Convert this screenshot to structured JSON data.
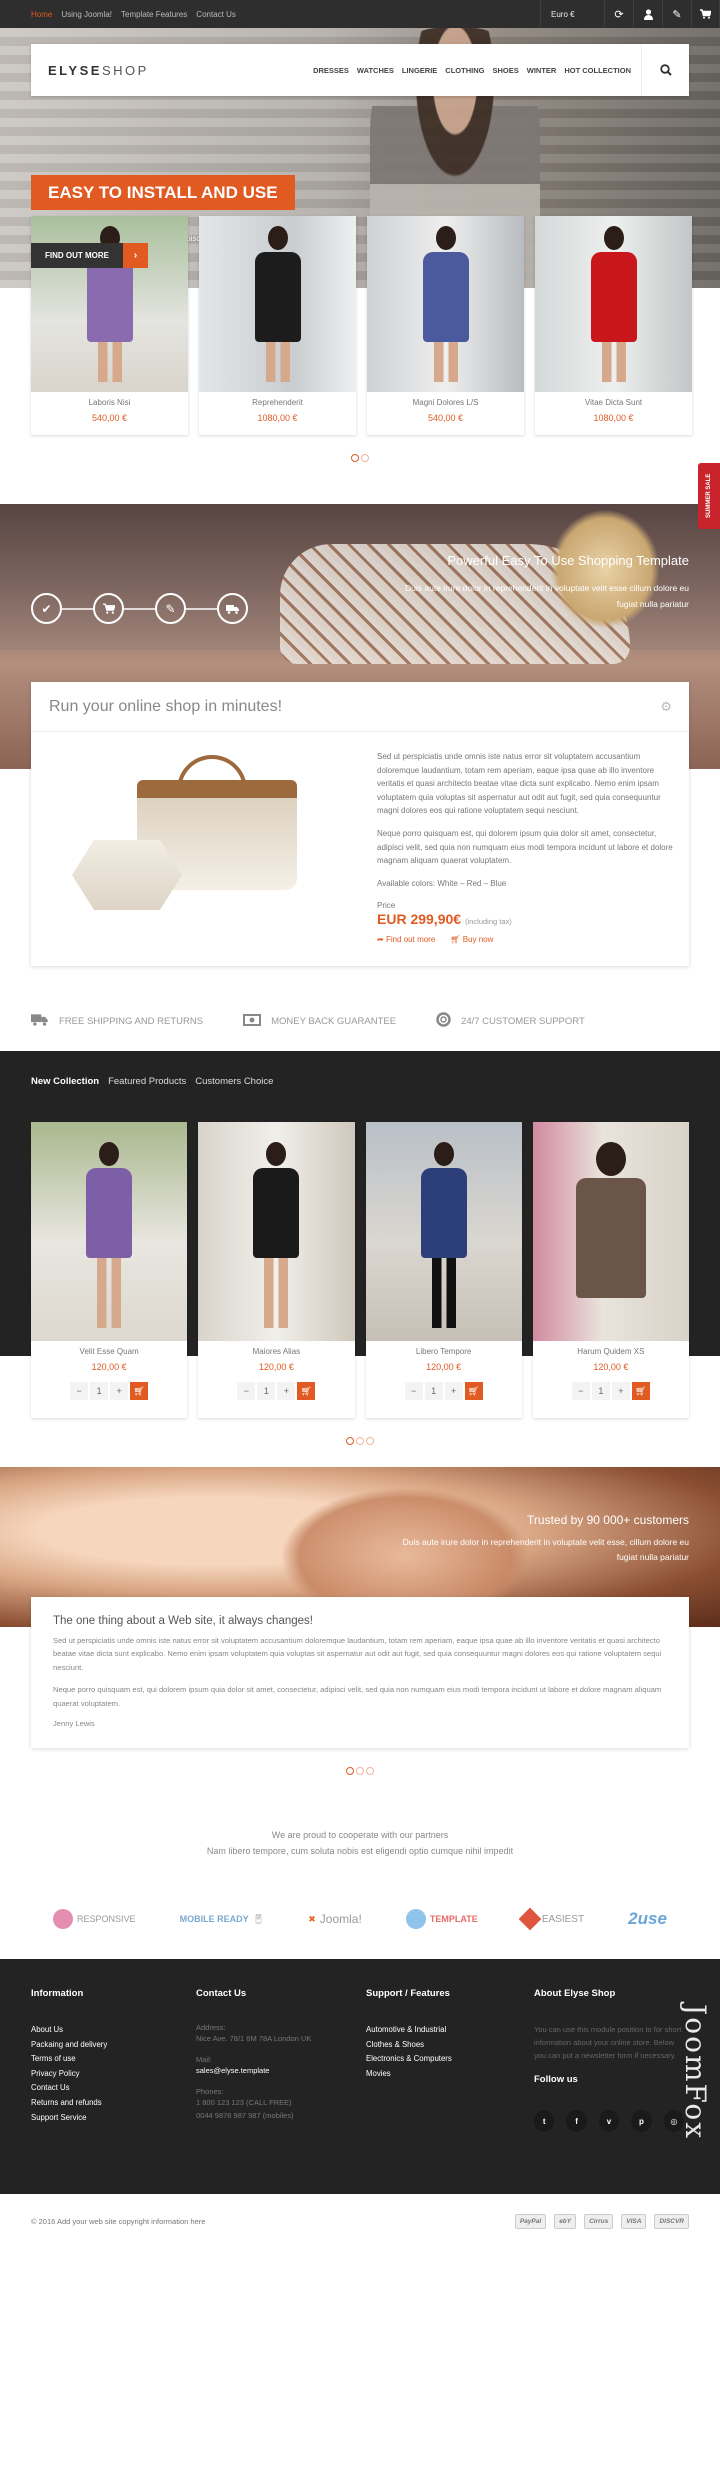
{
  "topbar": {
    "links": [
      {
        "label": "Home",
        "active": true
      },
      {
        "label": "Using Joomla!",
        "active": false
      },
      {
        "label": "Template Features",
        "active": false
      },
      {
        "label": "Contact Us",
        "active": false
      }
    ],
    "currency": "Euro €",
    "icons": [
      "refresh-icon",
      "user-icon",
      "pencil-icon",
      "cart-icon"
    ]
  },
  "header": {
    "logo_bold": "ELYSE",
    "logo_light": "SHOP",
    "menu": [
      "DRESSES",
      "WATCHES",
      "LINGERIE",
      "CLOTHING",
      "SHOES",
      "WINTER",
      "HOT COLLECTION"
    ],
    "search_icon": "search-icon"
  },
  "hero": {
    "title": "EASY TO INSTALL AND USE",
    "text": "Lorem ipsum dolor sit amet, consectetur adipiscing elit, sed do eiusmod tempor incididunt ut labore et dolore magna aliqua.",
    "button_label": "FIND OUT MORE",
    "button_arrow": "›"
  },
  "slider1": {
    "products": [
      {
        "name": "Laboris Nisi",
        "price": "540,00 €",
        "dress": "#8b6bb0"
      },
      {
        "name": "Reprehenderit",
        "price": "1080,00 €",
        "dress": "#1c1c1c"
      },
      {
        "name": "Magni Dolores L/S",
        "price": "540,00 €",
        "dress": "#4a5a9c"
      },
      {
        "name": "Vitae Dicta Sunt",
        "price": "1080,00 €",
        "dress": "#c8161c"
      }
    ],
    "pages": 2,
    "active_page": 1
  },
  "side_tab": "SUMMER SALE",
  "banner2": {
    "title": "Powerful Easy To Use Shopping Template",
    "text": "Duis aute irure dolor in reprehenderit in voluptate velit esse cillum dolore eu fugiat nulla pariatur",
    "steps": [
      "check-icon",
      "cart-icon",
      "pencil-icon",
      "truck-icon"
    ]
  },
  "shop_box": {
    "title": "Run your online shop in minutes!",
    "para1": "Sed ut perspiciatis unde omnis iste natus error sit voluptatem accusantium doloremque laudantium, totam rem aperiam, eaque ipsa quae ab illo inventore veritatis et quasi architecto beatae vitae dicta sunt explicabo. Nemo enim ipsam voluptatem quia voluptas sit aspernatur aut odit aut fugit, sed quia consequuntur magni dolores eos qui ratione voluptatem sequi nesciunt.",
    "para2": "Neque porro quisquam est, qui dolorem ipsum quia dolor sit amet, consectetur, adipisci velit, sed quia non numquam eius modi tempora incidunt ut labore et dolore magnam aliquam quaerat voluptatem.",
    "colors": "Available colors:  White – Red – Blue",
    "price_label": "Price",
    "price": "EUR 299,90€",
    "price_note": "(including tax)",
    "find_out": "Find out more",
    "buy_now": "Buy now"
  },
  "features": [
    {
      "icon": "truck-icon",
      "label": "FREE SHIPPING AND RETURNS"
    },
    {
      "icon": "money-icon",
      "label": "MONEY BACK GUARANTEE"
    },
    {
      "icon": "lifebuoy-icon",
      "label": "24/7 CUSTOMER SUPPORT"
    }
  ],
  "collection": {
    "tabs": [
      {
        "label": "New Collection",
        "active": true
      },
      {
        "label": "Featured Products",
        "active": false
      },
      {
        "label": "Customers Choice",
        "active": false
      }
    ],
    "products": [
      {
        "name": "Velit Esse Quam",
        "price": "120,00 €",
        "qty": "1",
        "dress": "#7d5fa8"
      },
      {
        "name": "Maiores Alias",
        "price": "120,00 €",
        "qty": "1",
        "dress": "#1a1a1a"
      },
      {
        "name": "Libero Tempore",
        "price": "120,00 €",
        "qty": "1",
        "dress": "#2d3f7a"
      },
      {
        "name": "Harum Quidem XS",
        "price": "120,00 €",
        "qty": "1",
        "dress": "#6b5548"
      }
    ],
    "minus": "−",
    "plus": "+",
    "pages": 3,
    "active_page": 1
  },
  "trusted": {
    "title": "Trusted by 90 000+ customers",
    "text": "Duis aute irure dolor in reprehenderit in voluptate velit esse, cillum dolore eu fugiat nulla pariatur"
  },
  "testimonial": {
    "title": "The one thing about a Web site, it always changes!",
    "para1": "Sed ut perspiciatis unde omnis iste natus error sit voluptatem accusantium doloremque laudantium, totam rem aperiam, eaque ipsa quae ab illo inventore veritatis et quasi architecto beatae vitae dicta sunt explicabo. Nemo enim ipsam voluptatem quia voluptas sit aspernatur aut odit aut fugit, sed quia consequuntur magni dolores eos qui ratione voluptatem sequi nesciunt.",
    "para2": "Neque porro quisquam est, qui dolorem ipsum quia dolor sit amet, consectetur, adipisci velit, sed quia non numquam eius modi tempora incidunt ut labore et dolore magnam aliquam quaerat voluptatem.",
    "author": "Jenny Lewis",
    "pages": 3,
    "active_page": 1
  },
  "partners": {
    "line1": "We are proud to cooperate with our partners",
    "line2": "Nam libero tempore, cum soluta nobis est eligendi optio cumque nihil impedit",
    "logos": [
      {
        "label": "RESPONSIVE",
        "color": "#e58fb0"
      },
      {
        "label": "MOBILE READY",
        "color": "#5a9fd4"
      },
      {
        "label": "Joomla!",
        "color": "#e26b2a"
      },
      {
        "label": "TEMPLATE",
        "color": "#8ec3ea"
      },
      {
        "label": "EASIEST",
        "color": "#e0553f"
      },
      {
        "label": "2use",
        "color": "#6aa5d8"
      }
    ]
  },
  "footer": {
    "info_title": "Information",
    "info_links": [
      "About Us",
      "Packaing and delivery",
      "Terms of use",
      "Privacy Policy",
      "Contact Us",
      "Returns and refunds",
      "Support Service"
    ],
    "contact_title": "Contact Us",
    "address_label": "Address:",
    "address": "Nice Ave. 78/1 6M 78A London UK",
    "mail_label": "Mail:",
    "mail": "sales@elyse.template",
    "phones_label": "Phones:",
    "phone1": "1 800 123 123 (CALL FREE)",
    "phone2": "0044 9876 987 987 (mobiles)",
    "support_title": "Support / Features",
    "support_links": [
      "Automotive & Industrial",
      "Clothes & Shoes",
      "Electronics & Computers",
      "Movies"
    ],
    "about_title": "About Elyse Shop",
    "about_text": "You can use this module position to for short information about your online store. Below you can put a newsletter form if necessary.",
    "follow_title": "Follow us",
    "social": [
      {
        "name": "twitter-icon",
        "glyph": "t"
      },
      {
        "name": "facebook-icon",
        "glyph": "f"
      },
      {
        "name": "vimeo-icon",
        "glyph": "v"
      },
      {
        "name": "pinterest-icon",
        "glyph": "p"
      },
      {
        "name": "dribbble-icon",
        "glyph": "◎"
      }
    ],
    "watermark": "JoomFox"
  },
  "bottom": {
    "copyright": "© 2016 Add your web site copyright information here",
    "payments": [
      "PayPal",
      "ebY",
      "Cirrus",
      "VISA",
      "DISCVR"
    ]
  }
}
